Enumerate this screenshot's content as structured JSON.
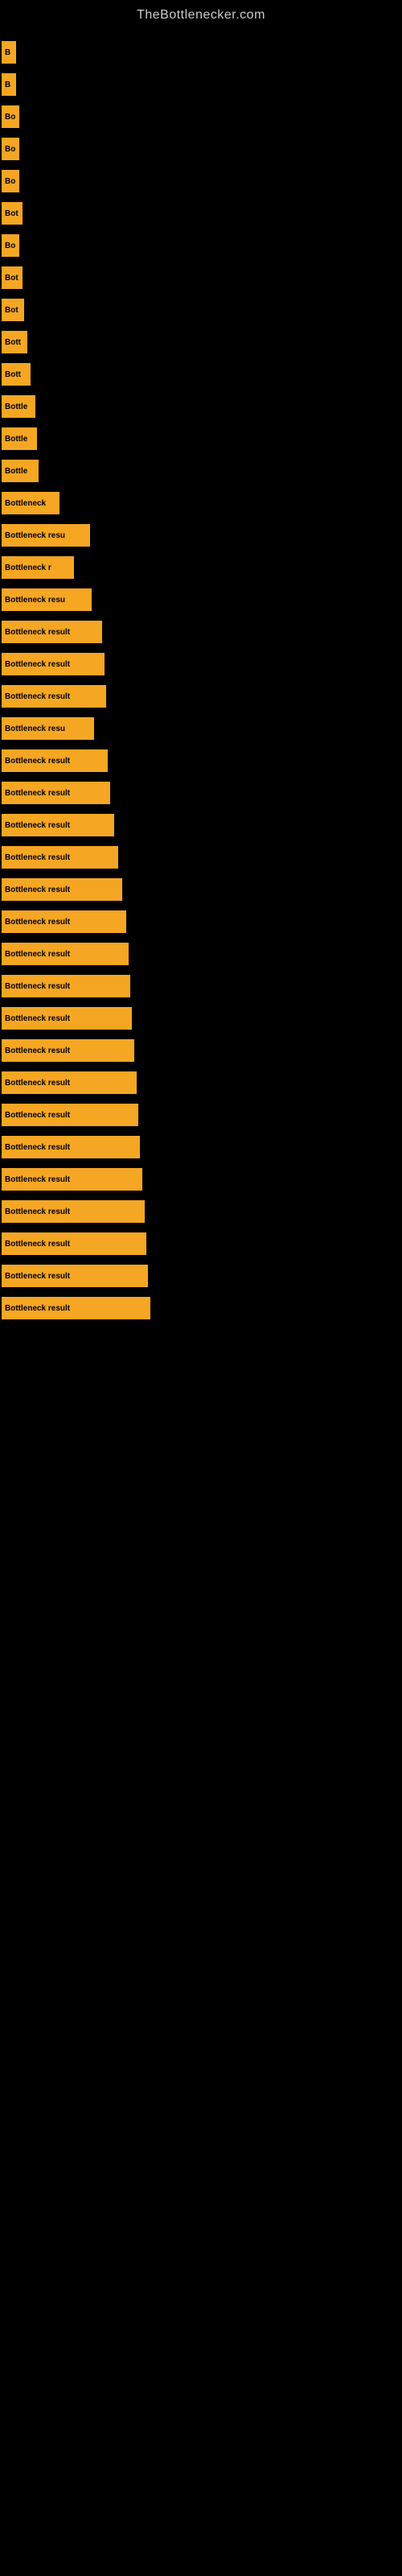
{
  "site": {
    "title": "TheBottlenecker.com"
  },
  "bars": [
    {
      "id": 1,
      "label": "B",
      "width": 18
    },
    {
      "id": 2,
      "label": "B",
      "width": 18
    },
    {
      "id": 3,
      "label": "Bo",
      "width": 22
    },
    {
      "id": 4,
      "label": "Bo",
      "width": 22
    },
    {
      "id": 5,
      "label": "Bo",
      "width": 22
    },
    {
      "id": 6,
      "label": "Bot",
      "width": 26
    },
    {
      "id": 7,
      "label": "Bo",
      "width": 22
    },
    {
      "id": 8,
      "label": "Bot",
      "width": 26
    },
    {
      "id": 9,
      "label": "Bot",
      "width": 28
    },
    {
      "id": 10,
      "label": "Bott",
      "width": 32
    },
    {
      "id": 11,
      "label": "Bott",
      "width": 36
    },
    {
      "id": 12,
      "label": "Bottle",
      "width": 42
    },
    {
      "id": 13,
      "label": "Bottle",
      "width": 44
    },
    {
      "id": 14,
      "label": "Bottle",
      "width": 46
    },
    {
      "id": 15,
      "label": "Bottleneck",
      "width": 72
    },
    {
      "id": 16,
      "label": "Bottleneck resu",
      "width": 110
    },
    {
      "id": 17,
      "label": "Bottleneck r",
      "width": 90
    },
    {
      "id": 18,
      "label": "Bottleneck resu",
      "width": 112
    },
    {
      "id": 19,
      "label": "Bottleneck result",
      "width": 125
    },
    {
      "id": 20,
      "label": "Bottleneck result",
      "width": 128
    },
    {
      "id": 21,
      "label": "Bottleneck result",
      "width": 130
    },
    {
      "id": 22,
      "label": "Bottleneck resu",
      "width": 115
    },
    {
      "id": 23,
      "label": "Bottleneck result",
      "width": 132
    },
    {
      "id": 24,
      "label": "Bottleneck result",
      "width": 135
    },
    {
      "id": 25,
      "label": "Bottleneck result",
      "width": 140
    },
    {
      "id": 26,
      "label": "Bottleneck result",
      "width": 145
    },
    {
      "id": 27,
      "label": "Bottleneck result",
      "width": 150
    },
    {
      "id": 28,
      "label": "Bottleneck result",
      "width": 155
    },
    {
      "id": 29,
      "label": "Bottleneck result",
      "width": 158
    },
    {
      "id": 30,
      "label": "Bottleneck result",
      "width": 160
    },
    {
      "id": 31,
      "label": "Bottleneck result",
      "width": 162
    },
    {
      "id": 32,
      "label": "Bottleneck result",
      "width": 165
    },
    {
      "id": 33,
      "label": "Bottleneck result",
      "width": 168
    },
    {
      "id": 34,
      "label": "Bottleneck result",
      "width": 170
    },
    {
      "id": 35,
      "label": "Bottleneck result",
      "width": 172
    },
    {
      "id": 36,
      "label": "Bottleneck result",
      "width": 175
    },
    {
      "id": 37,
      "label": "Bottleneck result",
      "width": 178
    },
    {
      "id": 38,
      "label": "Bottleneck result",
      "width": 180
    },
    {
      "id": 39,
      "label": "Bottleneck result",
      "width": 182
    },
    {
      "id": 40,
      "label": "Bottleneck result",
      "width": 185
    }
  ]
}
